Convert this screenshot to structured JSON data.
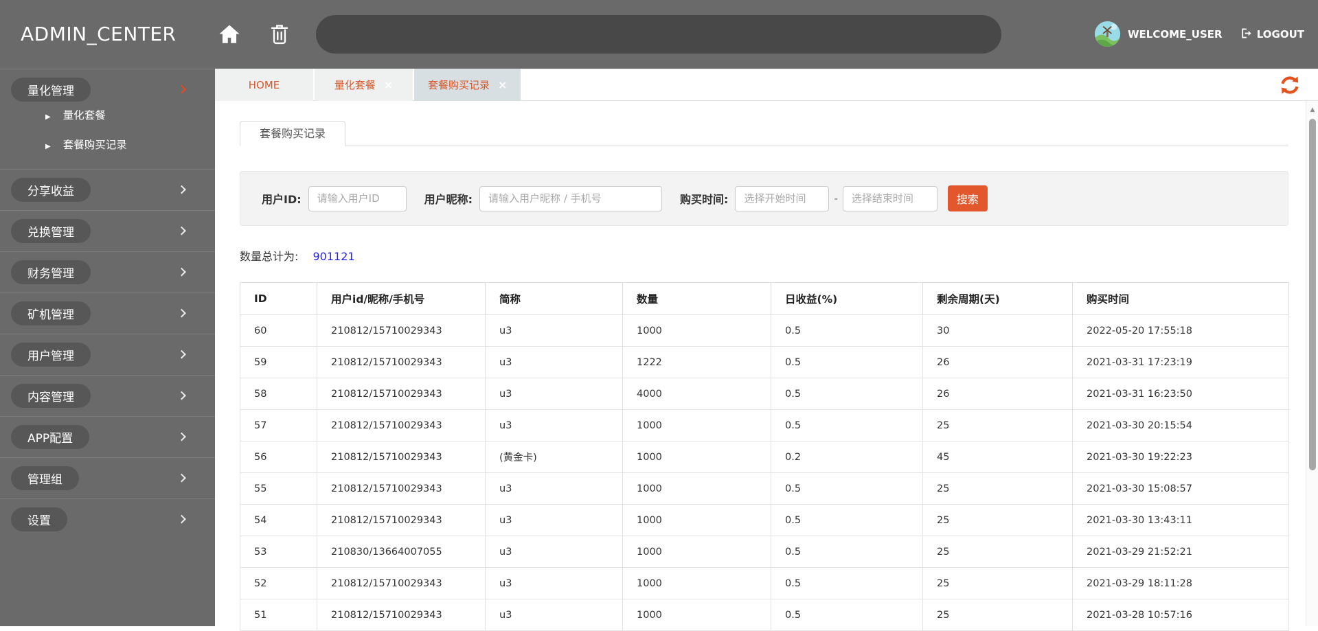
{
  "colors": {
    "accent_orange": "#e2572b",
    "refresh_orange": "#e3511d",
    "active_chevron_orange": "#e8491f",
    "header_gray": "#6a6a6a",
    "pill_gray": "#575757",
    "tab_bg": "#eff1f1",
    "tab_active_bg": "#d8dfe3",
    "tab_text_orange": "#d7592b",
    "link_blue": "#2323ee"
  },
  "icons": {
    "close": "×",
    "caret_right": "▶",
    "scroll_up": "▲",
    "home": "home-icon",
    "trash": "trash-icon",
    "logout": "logout-icon",
    "refresh": "refresh-icon",
    "chevron": "chevron-right-icon"
  },
  "header": {
    "title": "ADMIN_CENTER",
    "welcome": "WELCOME_USER",
    "logout": "LOGOUT"
  },
  "sidebar": {
    "items": [
      {
        "label": "量化管理",
        "active": true,
        "children": [
          "量化套餐",
          "套餐购买记录"
        ]
      },
      {
        "label": "分享收益"
      },
      {
        "label": "兑换管理"
      },
      {
        "label": "财务管理"
      },
      {
        "label": "矿机管理"
      },
      {
        "label": "用户管理"
      },
      {
        "label": "内容管理"
      },
      {
        "label": "APP配置"
      },
      {
        "label": "管理组"
      },
      {
        "label": "设置"
      }
    ]
  },
  "tabs": [
    {
      "label": "HOME",
      "closable": false,
      "active": false
    },
    {
      "label": "量化套餐",
      "closable": true,
      "active": false
    },
    {
      "label": "套餐购买记录",
      "closable": true,
      "active": true
    }
  ],
  "page": {
    "inner_tab": "套餐购买记录",
    "filter": {
      "user_id_label": "用户ID:",
      "user_id_placeholder": "请输入用户ID",
      "nickname_label": "用户昵称:",
      "nickname_placeholder": "请输入用户昵称 / 手机号",
      "time_label": "购买时间:",
      "time_start_placeholder": "选择开始时间",
      "time_end_placeholder": "选择结束时间",
      "range_separator": "-",
      "search_label": "搜索"
    },
    "total_label": "数量总计为:",
    "total_value": "901121"
  },
  "table": {
    "columns": [
      "ID",
      "用户id/昵称/手机号",
      "简称",
      "数量",
      "日收益(%)",
      "剩余周期(天)",
      "购买时间"
    ],
    "rows": [
      [
        "60",
        "210812/15710029343",
        "u3",
        "1000",
        "0.5",
        "30",
        "2022-05-20 17:55:18"
      ],
      [
        "59",
        "210812/15710029343",
        "u3",
        "1222",
        "0.5",
        "26",
        "2021-03-31 17:23:19"
      ],
      [
        "58",
        "210812/15710029343",
        "u3",
        "4000",
        "0.5",
        "26",
        "2021-03-31 16:23:50"
      ],
      [
        "57",
        "210812/15710029343",
        "u3",
        "1000",
        "0.5",
        "25",
        "2021-03-30 20:15:54"
      ],
      [
        "56",
        "210812/15710029343",
        "(黄金卡)",
        "1000",
        "0.2",
        "45",
        "2021-03-30 19:22:23"
      ],
      [
        "55",
        "210812/15710029343",
        "u3",
        "1000",
        "0.5",
        "25",
        "2021-03-30 15:08:57"
      ],
      [
        "54",
        "210812/15710029343",
        "u3",
        "1000",
        "0.5",
        "25",
        "2021-03-30 13:43:11"
      ],
      [
        "53",
        "210830/13664007055",
        "u3",
        "1000",
        "0.5",
        "25",
        "2021-03-29 21:52:21"
      ],
      [
        "52",
        "210812/15710029343",
        "u3",
        "1000",
        "0.5",
        "25",
        "2021-03-29 18:11:28"
      ],
      [
        "51",
        "210812/15710029343",
        "u3",
        "1000",
        "0.5",
        "25",
        "2021-03-28 10:57:16"
      ]
    ]
  }
}
